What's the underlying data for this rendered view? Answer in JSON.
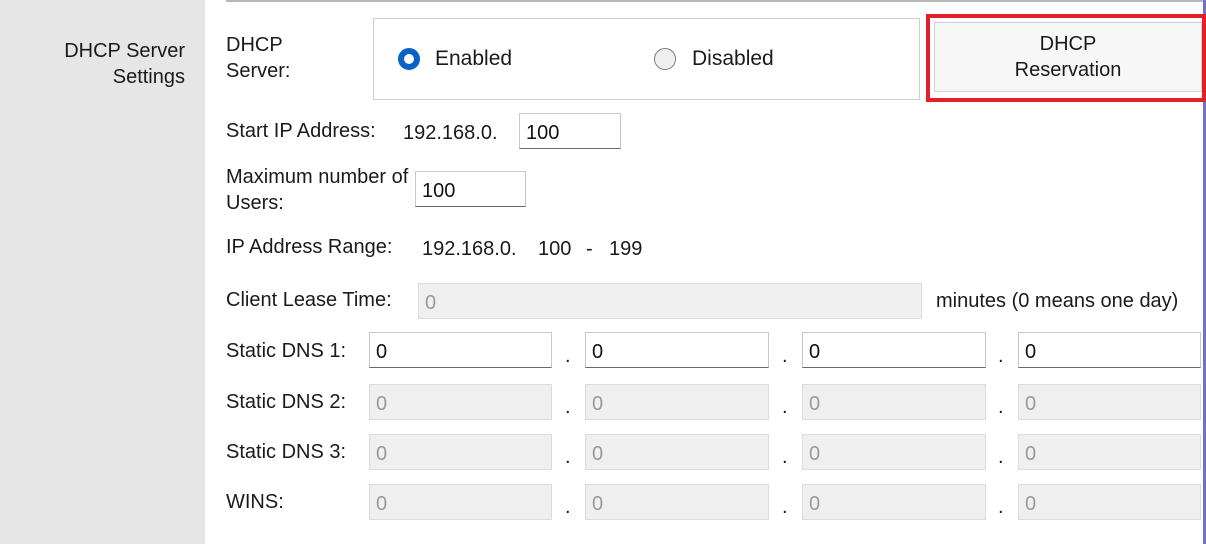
{
  "sidebar": {
    "title": "DHCP Server Settings"
  },
  "dhcp_server": {
    "label": "DHCP Server:",
    "enabled_label": "Enabled",
    "disabled_label": "Disabled",
    "selected": "Enabled",
    "reservation_button": {
      "line1": "DHCP",
      "line2": "Reservation"
    }
  },
  "start_ip": {
    "label": "Start IP Address:",
    "prefix": "192.168.0.",
    "value": "100"
  },
  "max_users": {
    "label": "Maximum number of Users:",
    "value": "100"
  },
  "ip_range": {
    "label": "IP Address Range:",
    "prefix": "192.168.0.",
    "start": "100",
    "separator": "-",
    "end": "199"
  },
  "lease": {
    "label": "Client Lease Time:",
    "value": "0",
    "suffix": "minutes (0 means one day)"
  },
  "static_dns_1": {
    "label": "Static DNS 1:",
    "octets": [
      "0",
      "0",
      "0",
      "0"
    ]
  },
  "static_dns_2": {
    "label": "Static DNS 2:",
    "octets": [
      "0",
      "0",
      "0",
      "0"
    ]
  },
  "static_dns_3": {
    "label": "Static DNS 3:",
    "octets": [
      "0",
      "0",
      "0",
      "0"
    ]
  },
  "wins": {
    "label": "WINS:",
    "octets": [
      "0",
      "0",
      "0",
      "0"
    ]
  },
  "colors": {
    "accent_blue": "#0a62c7",
    "highlight_red": "#e3202a",
    "sidebar_bg": "#e6e6e6"
  }
}
